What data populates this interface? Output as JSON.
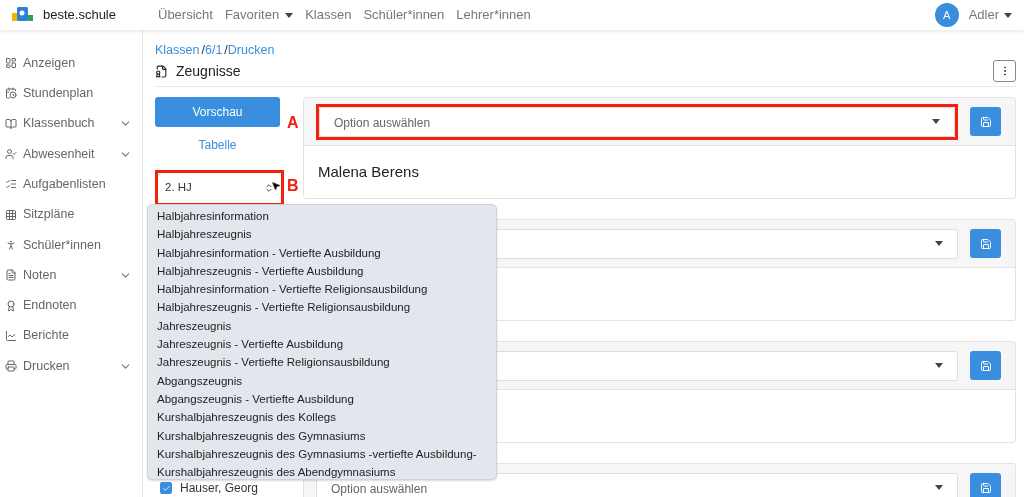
{
  "navbar": {
    "brand": "beste.schule",
    "links": [
      {
        "label": "Übersicht",
        "dropdown": false
      },
      {
        "label": "Favoriten",
        "dropdown": true
      },
      {
        "label": "Klassen",
        "dropdown": false
      },
      {
        "label": "Schüler*innen",
        "dropdown": false
      },
      {
        "label": "Lehrer*innen",
        "dropdown": false
      }
    ],
    "avatar": "A",
    "user": "Adler"
  },
  "sidebar": {
    "items": [
      {
        "label": "Anzeigen",
        "expandable": false
      },
      {
        "label": "Stundenplan",
        "expandable": false
      },
      {
        "label": "Klassenbuch",
        "expandable": true
      },
      {
        "label": "Abwesenheit",
        "expandable": true
      },
      {
        "label": "Aufgabenlisten",
        "expandable": false
      },
      {
        "label": "Sitzpläne",
        "expandable": false
      },
      {
        "label": "Schüler*innen",
        "expandable": false
      },
      {
        "label": "Noten",
        "expandable": true
      },
      {
        "label": "Endnoten",
        "expandable": false
      },
      {
        "label": "Berichte",
        "expandable": false
      },
      {
        "label": "Drucken",
        "expandable": true
      }
    ]
  },
  "breadcrumb": {
    "separator": "/",
    "items": [
      "Klassen",
      "6/1",
      "Drucken"
    ]
  },
  "page_title": "Zeugnisse",
  "actions": {
    "preview": "Vorschau",
    "table": "Tabelle"
  },
  "semester_select": {
    "value": "2. HJ"
  },
  "dropdown_options": [
    "Halbjahresinformation",
    "Halbjahreszeugnis",
    "Halbjahresinformation - Vertiefte Ausbildung",
    "Halbjahreszeugnis - Vertiefte Ausbildung",
    "Halbjahresinformation - Vertiefte Religionsausbildung",
    "Halbjahreszeugnis - Vertiefte Religionsausbildung",
    "Jahreszeugnis",
    "Jahreszeugnis - Vertiefte Ausbildung",
    "Jahreszeugnis - Vertiefte Religionsausbildung",
    "Abgangszeugnis",
    "Abgangszeugnis - Vertiefte Ausbildung",
    "Kurshalbjahreszeugnis des Kollegs",
    "Kurshalbjahreszeugnis des Gymnasiums",
    "Kurshalbjahreszeugnis des Gymnasiums -vertiefte Ausbildung-",
    "Kurshalbjahreszeugnis des Abendgymnasiums"
  ],
  "student_rows": [
    {
      "name": "Hauser, Georg",
      "checked": true
    }
  ],
  "cards": [
    {
      "placeholder": "Option auswählen",
      "student": "Malena Berens",
      "highlighted": true
    },
    {
      "highlighted": false
    },
    {
      "highlighted": false
    },
    {
      "placeholder": "Option auswählen",
      "highlighted": false
    }
  ],
  "annotations": [
    "A",
    "B"
  ]
}
